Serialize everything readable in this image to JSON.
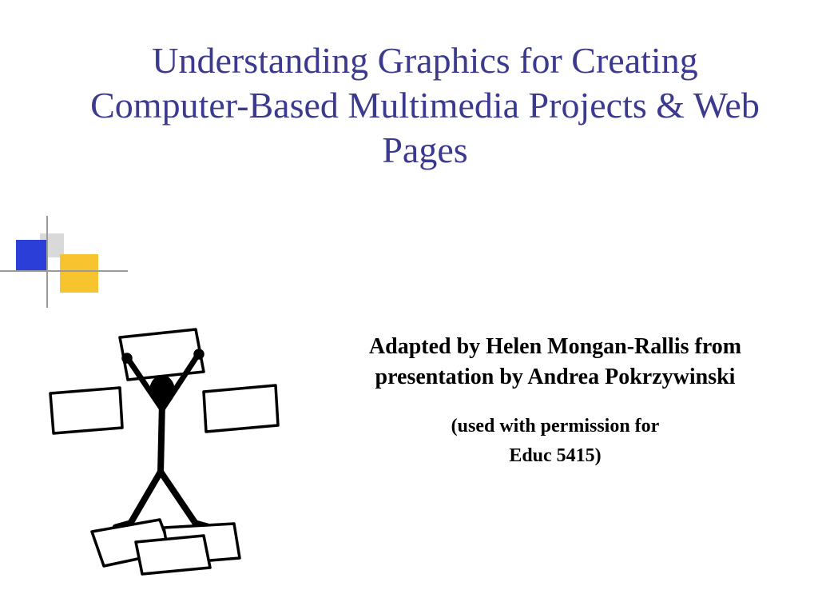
{
  "title": "Understanding Graphics for Creating Computer-Based Multimedia Projects & Web Pages",
  "credit": "Adapted by Helen Mongan-Rallis from presentation by Andrea Pokrzywinski",
  "permission_line1": "(used with permission for",
  "permission_line2": "Educ 5415)",
  "colors": {
    "title": "#3b3a8e",
    "accent_blue": "#2b3fd8",
    "accent_yellow": "#f7c32f",
    "accent_gray": "#d9d9d9",
    "rule": "#9a9a9a"
  }
}
